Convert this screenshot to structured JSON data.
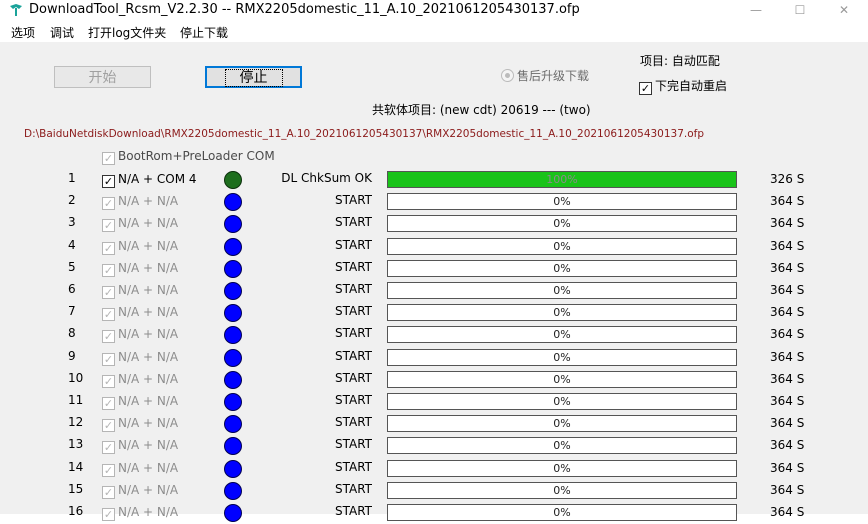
{
  "window": {
    "title": "DownloadTool_Rcsm_V2.2.30   --   RMX2205domestic_11_A.10_2021061205430137.ofp",
    "min_glyph": "—",
    "max_glyph": "☐",
    "close_glyph": "✕"
  },
  "menu": [
    "选项",
    "调试",
    "打开log文件夹",
    "停止下载"
  ],
  "controls": {
    "start_label": "开始",
    "stop_label": "停止",
    "radio_label": "售后升级下载",
    "project_label": "项目:  自动匹配",
    "auto_reboot_label": "下完自动重启",
    "auto_reboot_checked": true,
    "total_project_label": "共软体项目: (new cdt)  20619  --- (two)"
  },
  "file_path": "D:\\BaiduNetdiskDownload\\RMX2205domestic_11_A.10_2021061205430137\\RMX2205domestic_11_A.10_2021061205430137.ofp",
  "bootrom": {
    "label": "BootRom+PreLoader COM",
    "checked": true
  },
  "colors": {
    "progress_fill": "#19c319",
    "dot_idle": "#0000ff",
    "dot_done": "#1e6e1e",
    "path_text": "#8b1a1a"
  },
  "devices": [
    {
      "index": "1",
      "port": "N/A + COM  4",
      "checked": true,
      "enabled": true,
      "dot": "green",
      "status": "DL ChkSum OK",
      "progress_text": "100%",
      "progress": 1.0,
      "time": "326 S"
    },
    {
      "index": "2",
      "port": "N/A + N/A",
      "checked": true,
      "enabled": false,
      "dot": "blue",
      "status": "START",
      "progress_text": "0%",
      "progress": 0,
      "time": "364 S"
    },
    {
      "index": "3",
      "port": "N/A + N/A",
      "checked": true,
      "enabled": false,
      "dot": "blue",
      "status": "START",
      "progress_text": "0%",
      "progress": 0,
      "time": "364 S"
    },
    {
      "index": "4",
      "port": "N/A + N/A",
      "checked": true,
      "enabled": false,
      "dot": "blue",
      "status": "START",
      "progress_text": "0%",
      "progress": 0,
      "time": "364 S"
    },
    {
      "index": "5",
      "port": "N/A + N/A",
      "checked": true,
      "enabled": false,
      "dot": "blue",
      "status": "START",
      "progress_text": "0%",
      "progress": 0,
      "time": "364 S"
    },
    {
      "index": "6",
      "port": "N/A + N/A",
      "checked": true,
      "enabled": false,
      "dot": "blue",
      "status": "START",
      "progress_text": "0%",
      "progress": 0,
      "time": "364 S"
    },
    {
      "index": "7",
      "port": "N/A + N/A",
      "checked": true,
      "enabled": false,
      "dot": "blue",
      "status": "START",
      "progress_text": "0%",
      "progress": 0,
      "time": "364 S"
    },
    {
      "index": "8",
      "port": "N/A + N/A",
      "checked": true,
      "enabled": false,
      "dot": "blue",
      "status": "START",
      "progress_text": "0%",
      "progress": 0,
      "time": "364 S"
    },
    {
      "index": "9",
      "port": "N/A + N/A",
      "checked": true,
      "enabled": false,
      "dot": "blue",
      "status": "START",
      "progress_text": "0%",
      "progress": 0,
      "time": "364 S"
    },
    {
      "index": "10",
      "port": "N/A + N/A",
      "checked": true,
      "enabled": false,
      "dot": "blue",
      "status": "START",
      "progress_text": "0%",
      "progress": 0,
      "time": "364 S"
    },
    {
      "index": "11",
      "port": "N/A + N/A",
      "checked": true,
      "enabled": false,
      "dot": "blue",
      "status": "START",
      "progress_text": "0%",
      "progress": 0,
      "time": "364 S"
    },
    {
      "index": "12",
      "port": "N/A + N/A",
      "checked": true,
      "enabled": false,
      "dot": "blue",
      "status": "START",
      "progress_text": "0%",
      "progress": 0,
      "time": "364 S"
    },
    {
      "index": "13",
      "port": "N/A + N/A",
      "checked": true,
      "enabled": false,
      "dot": "blue",
      "status": "START",
      "progress_text": "0%",
      "progress": 0,
      "time": "364 S"
    },
    {
      "index": "14",
      "port": "N/A + N/A",
      "checked": true,
      "enabled": false,
      "dot": "blue",
      "status": "START",
      "progress_text": "0%",
      "progress": 0,
      "time": "364 S"
    },
    {
      "index": "15",
      "port": "N/A + N/A",
      "checked": true,
      "enabled": false,
      "dot": "blue",
      "status": "START",
      "progress_text": "0%",
      "progress": 0,
      "time": "364 S"
    },
    {
      "index": "16",
      "port": "N/A + N/A",
      "checked": true,
      "enabled": false,
      "dot": "blue",
      "status": "START",
      "progress_text": "0%",
      "progress": 0,
      "time": "364 S"
    }
  ]
}
